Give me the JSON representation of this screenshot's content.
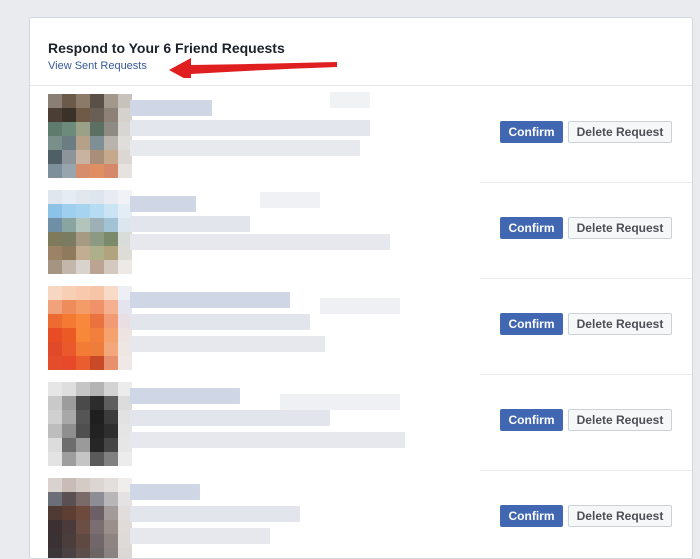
{
  "header": {
    "title": "Respond to Your 6 Friend Requests",
    "sent_link": "View Sent Requests"
  },
  "colors": {
    "accent": "#4267b2",
    "link": "#365899",
    "arrow": "#e02020"
  },
  "requests": [
    {
      "confirm_label": "Confirm",
      "delete_label": "Delete Request",
      "avatar": [
        "#8a7f74",
        "#6b5a4a",
        "#8c7a69",
        "#5a5048",
        "#a3988c",
        "#c7c2bc",
        "#4b3f35",
        "#3a3129",
        "#6e5a47",
        "#6a5f55",
        "#8d8177",
        "#d5d1cc",
        "#5e7b6d",
        "#6d8b7a",
        "#9aa186",
        "#5c6f63",
        "#8e8b84",
        "#d8d6d2",
        "#7a8e8a",
        "#6b7d82",
        "#b5a08a",
        "#7f8f96",
        "#b8b3ad",
        "#e0dedb",
        "#4f5f66",
        "#8d949a",
        "#c8b2a0",
        "#a98f7a",
        "#c6a88c",
        "#dcd7d2",
        "#7c8f9a",
        "#97a6ae",
        "#d58d6b",
        "#e08f62",
        "#d6896a",
        "#e6e2df"
      ]
    },
    {
      "confirm_label": "Confirm",
      "delete_label": "Delete Request",
      "avatar": [
        "#dfe6ee",
        "#e6ecf3",
        "#e2e7ee",
        "#dfe5ee",
        "#e8ecf2",
        "#f0f2f6",
        "#8cc2e6",
        "#9fcfee",
        "#a7d3ef",
        "#b5dcf2",
        "#cbe4f4",
        "#e2edf6",
        "#6f8fa6",
        "#8aa4a0",
        "#b3c4bc",
        "#9cb0b6",
        "#a2c3d6",
        "#dbe6ee",
        "#7f7a5b",
        "#7a7c62",
        "#a69a82",
        "#8c9a84",
        "#7a8a6a",
        "#d9ddd9",
        "#9c8266",
        "#8f7a5e",
        "#c2ad93",
        "#aeb08c",
        "#b0a37d",
        "#dedcd7",
        "#a69483",
        "#c3b7ab",
        "#d9d3cd",
        "#bba491",
        "#d3c9be",
        "#ece9e6"
      ]
    },
    {
      "confirm_label": "Confirm",
      "delete_label": "Delete Request",
      "avatar": [
        "#f7d7c4",
        "#f6cfb5",
        "#f8c9ac",
        "#f6c4a6",
        "#f9d9c8",
        "#eeeef5",
        "#f2a27b",
        "#ee8c5c",
        "#f39c68",
        "#f0916a",
        "#f5b08f",
        "#e3e4ee",
        "#ee6a33",
        "#f47a34",
        "#f8883b",
        "#e9723e",
        "#f29a73",
        "#e9dfe3",
        "#e84c25",
        "#ec5a23",
        "#f7883a",
        "#f37f3c",
        "#f5a26e",
        "#ede3e0",
        "#e04a2a",
        "#e9592c",
        "#f27c36",
        "#ee7d3b",
        "#f3a77a",
        "#eee6e3",
        "#e44d2c",
        "#e74a2a",
        "#ea5d2f",
        "#c94a26",
        "#e88f6d",
        "#efe8e6"
      ]
    },
    {
      "confirm_label": "Confirm",
      "delete_label": "Delete Request",
      "avatar": [
        "#e6e6e6",
        "#dedede",
        "#c5c5c5",
        "#b4b4b4",
        "#d3d3d3",
        "#ececec",
        "#c9c9c9",
        "#9c9c9c",
        "#4a4a4a",
        "#2c2c2c",
        "#5e5e5e",
        "#dcdcdc",
        "#d0d0d0",
        "#a8a8a8",
        "#555555",
        "#1f1f1f",
        "#3b3b3b",
        "#e2e2e2",
        "#bdbdbd",
        "#8f8f8f",
        "#4f4f4f",
        "#222222",
        "#2e2e2e",
        "#e5e5e5",
        "#dcdcdc",
        "#6d6d6d",
        "#9a9a9a",
        "#262626",
        "#454545",
        "#e6e6e6",
        "#e3e3e3",
        "#9e9e9e",
        "#c5c5c5",
        "#5a5a5a",
        "#808080",
        "#ececec"
      ]
    },
    {
      "confirm_label": "Confirm",
      "delete_label": "Delete Request",
      "avatar": [
        "#d9d2ce",
        "#c9bcb6",
        "#d5cbc6",
        "#dcd6d3",
        "#e3dfdc",
        "#efeeed",
        "#6c6f7a",
        "#5a4f52",
        "#7a6a6a",
        "#8d8d95",
        "#b9b6b8",
        "#e4e2e2",
        "#4f3a34",
        "#5e3d32",
        "#6e4a3c",
        "#6d5f66",
        "#a39a9a",
        "#e0dddc",
        "#3d3033",
        "#4a3a3a",
        "#6b4f44",
        "#7a6e72",
        "#9b8f8c",
        "#dedbd9",
        "#3a3135",
        "#4b3d3b",
        "#5f4a41",
        "#716669",
        "#8e8482",
        "#dddad8",
        "#3c3538",
        "#4a4144",
        "#5c4f4b",
        "#6d6466",
        "#8a8381",
        "#dbd8d6"
      ]
    }
  ]
}
